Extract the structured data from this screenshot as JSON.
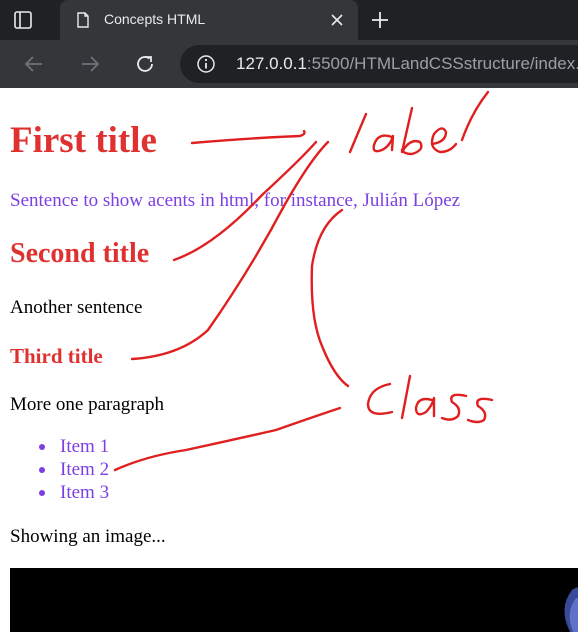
{
  "browser": {
    "tab_title": "Concepts HTML",
    "url_host": "127.0.0.1",
    "url_rest": ":5500/HTMLandCSSstructure/index."
  },
  "page": {
    "title1": "First title",
    "accent_sentence": "Sentence to show acents in html, for instance, Julián López",
    "title2": "Second title",
    "sentence2": "Another sentence",
    "title3": "Third title",
    "paragraph3": "More one paragraph",
    "list_items": [
      "Item 1",
      "Item 2",
      "Item 3"
    ],
    "image_caption": "Showing an image..."
  },
  "annotations": {
    "label_word": "label",
    "class_word": "class"
  },
  "colors": {
    "heading": "#e03131",
    "accent": "#7b3fe4",
    "annotation": "#e02020"
  }
}
